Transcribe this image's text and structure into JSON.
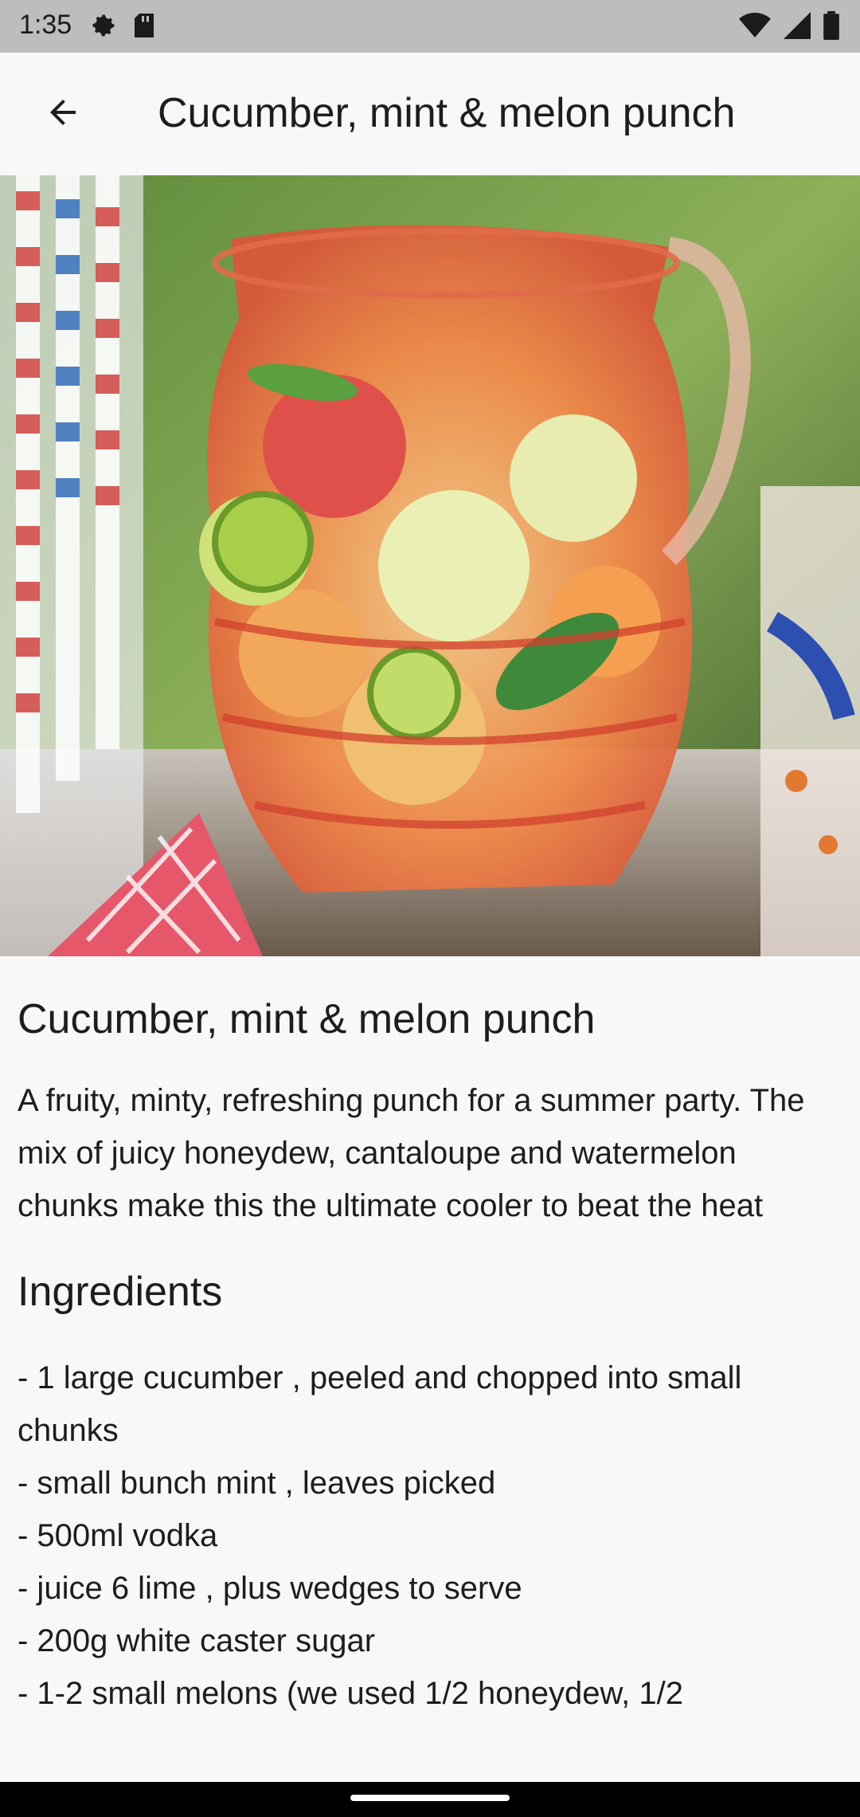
{
  "status_bar": {
    "time": "1:35",
    "left_icons": [
      "gear-icon",
      "sd-card-icon"
    ],
    "right_icons": [
      "wifi-icon",
      "signal-icon",
      "battery-icon"
    ]
  },
  "app_bar": {
    "back_icon": "arrow-back-icon",
    "title": "Cucumber, mint & melon punch"
  },
  "hero_image": {
    "description_icon": "recipe-photo"
  },
  "recipe": {
    "title": "Cucumber, mint & melon punch",
    "description": "A fruity, minty, refreshing punch for a summer party. The mix of juicy honeydew, cantaloupe and watermelon chunks make this the ultimate cooler to beat the heat",
    "ingredients_heading": "Ingredients",
    "ingredients": [
      " - 1 large cucumber , peeled and chopped into small chunks",
      " - small bunch mint , leaves picked",
      " - 500ml vodka",
      " - juice 6 lime , plus wedges to serve",
      " - 200g white caster sugar",
      " - 1-2 small melons (we used 1/2 honeydew, 1/2"
    ]
  },
  "colors": {
    "background": "#f8f8f9",
    "status_bar": "#bdbdbd",
    "text": "#1d1d1f"
  }
}
